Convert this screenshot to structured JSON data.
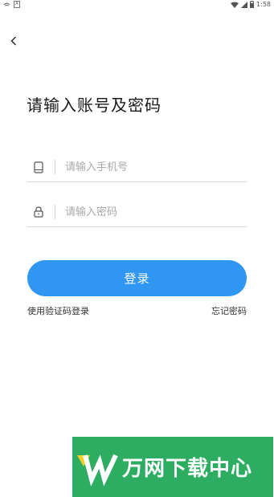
{
  "status_bar": {
    "left_badge": "A",
    "time": "1:58"
  },
  "page": {
    "title": "请输入账号及密码"
  },
  "form": {
    "phone_placeholder": "请输入手机号",
    "password_placeholder": "请输入密码",
    "login_label": "登录",
    "sms_login_link": "使用验证码登录",
    "forgot_password_link": "忘记密码"
  },
  "banner": {
    "text": "万网下载中心"
  },
  "colors": {
    "primary": "#2f96f1",
    "banner_green": "#2cad62"
  },
  "icons": [
    "back-arrow-icon",
    "phone-icon",
    "lock-icon",
    "wifi-icon",
    "signal-icon",
    "battery-icon"
  ]
}
